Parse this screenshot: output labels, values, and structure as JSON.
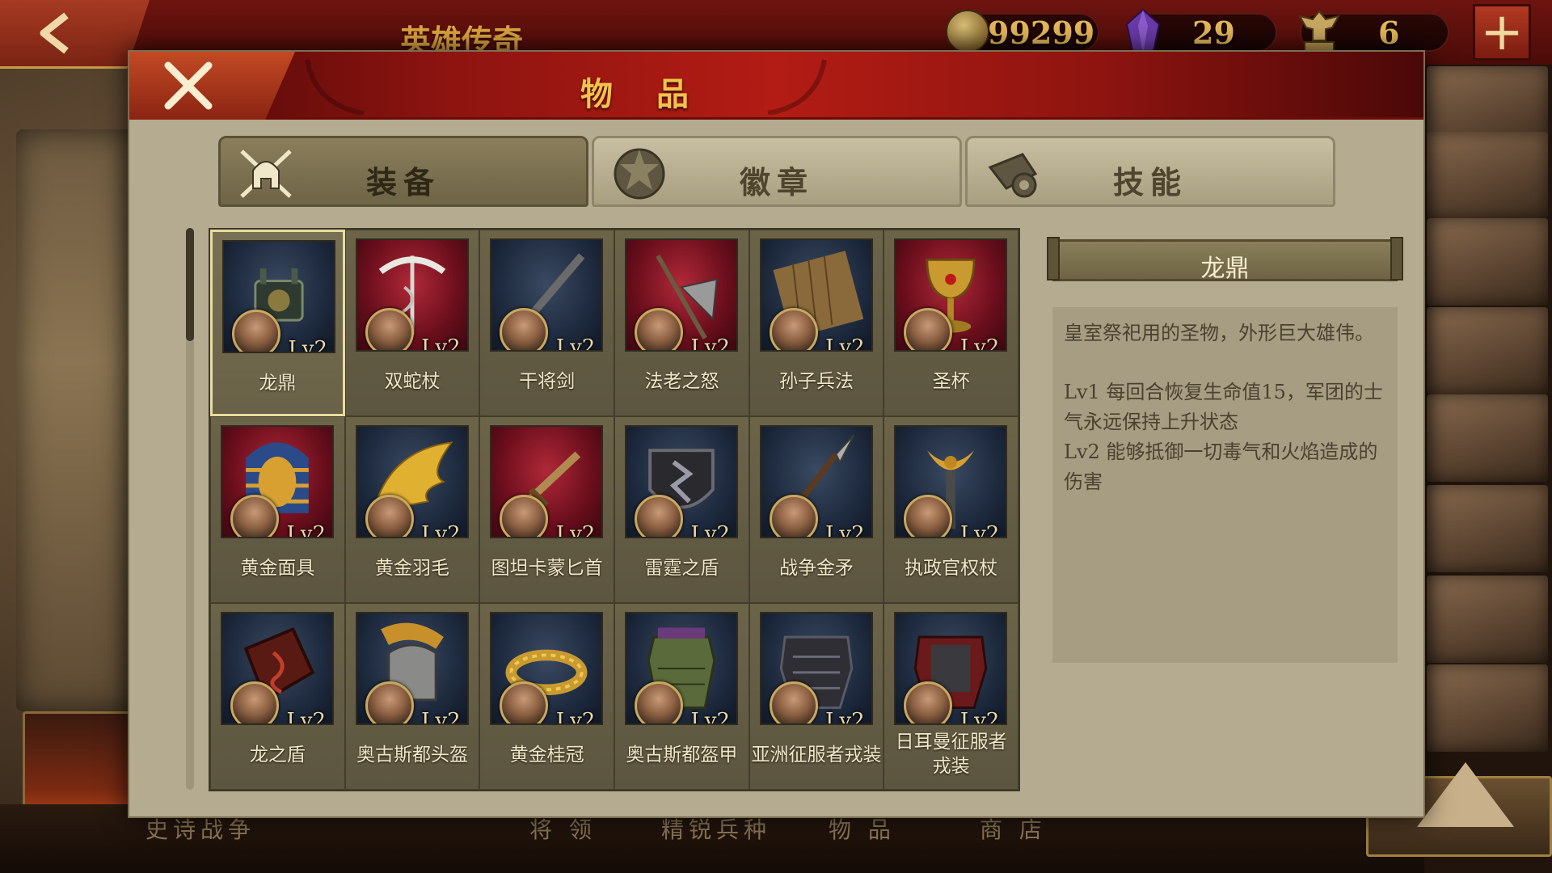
{
  "hud": {
    "title": "英雄传奇",
    "gold": "99299",
    "gems": "29",
    "spqr": "6",
    "back_icon": "chevron-left-icon",
    "plus_icon": "plus-icon"
  },
  "background_nav": [
    "史诗战争",
    "将 领",
    "精锐兵种",
    "物 品",
    "商 店"
  ],
  "dialog": {
    "title": "物 品",
    "tabs": [
      {
        "label": "装备",
        "icon": "helmet-swords-icon",
        "active": true
      },
      {
        "label": "徽章",
        "icon": "emblem-icon",
        "active": false
      },
      {
        "label": "技能",
        "icon": "scroll-icon",
        "active": false
      }
    ],
    "items": [
      {
        "name": "龙鼎",
        "level": "Lv2",
        "art": "cauldron",
        "bg": "blue",
        "selected": true
      },
      {
        "name": "双蛇杖",
        "level": "Lv2",
        "art": "caduceus",
        "bg": "red"
      },
      {
        "name": "干将剑",
        "level": "Lv2",
        "art": "sword",
        "bg": "blue"
      },
      {
        "name": "法老之怒",
        "level": "Lv2",
        "art": "axe",
        "bg": "red"
      },
      {
        "name": "孙子兵法",
        "level": "Lv2",
        "art": "bamboo-scroll",
        "bg": "blue"
      },
      {
        "name": "圣杯",
        "level": "Lv2",
        "art": "grail",
        "bg": "red"
      },
      {
        "name": "黄金面具",
        "level": "Lv2",
        "art": "pharaoh-mask",
        "bg": "red"
      },
      {
        "name": "黄金羽毛",
        "level": "Lv2",
        "art": "golden-wing",
        "bg": "blue"
      },
      {
        "name": "图坦卡蒙匕首",
        "level": "Lv2",
        "art": "dagger",
        "bg": "red"
      },
      {
        "name": "雷霆之盾",
        "level": "Lv2",
        "art": "thunder-shield",
        "bg": "blue"
      },
      {
        "name": "战争金矛",
        "level": "Lv2",
        "art": "spear",
        "bg": "blue"
      },
      {
        "name": "执政官权杖",
        "level": "Lv2",
        "art": "eagle-scepter",
        "bg": "blue"
      },
      {
        "name": "龙之盾",
        "level": "Lv2",
        "art": "dragon-shield",
        "bg": "blue"
      },
      {
        "name": "奥古斯都头盔",
        "level": "Lv2",
        "art": "crested-helmet",
        "bg": "blue"
      },
      {
        "name": "黄金桂冠",
        "level": "Lv2",
        "art": "laurel-wreath",
        "bg": "blue"
      },
      {
        "name": "奥古斯都盔甲",
        "level": "Lv2",
        "art": "armor",
        "bg": "blue"
      },
      {
        "name": "亚洲征服者戎装",
        "level": "Lv2",
        "art": "dark-armor",
        "bg": "blue"
      },
      {
        "name": "日耳曼征服者戎装",
        "level": "Lv2",
        "art": "red-armor",
        "bg": "blue"
      }
    ],
    "detail": {
      "title": "龙鼎",
      "description": "皇室祭祀用的圣物，外形巨大雄伟。",
      "lines": [
        "Lv1  每回合恢复生命值15，军团的士气永远保持上升状态",
        "Lv2  能够抵御一切毒气和火焰造成的伤害"
      ]
    }
  },
  "colors": {
    "header_red": "#b21c14",
    "title_gold": "#f2c24a",
    "panel_beige": "#b4ab90",
    "cell_olive": "#5c5540"
  }
}
